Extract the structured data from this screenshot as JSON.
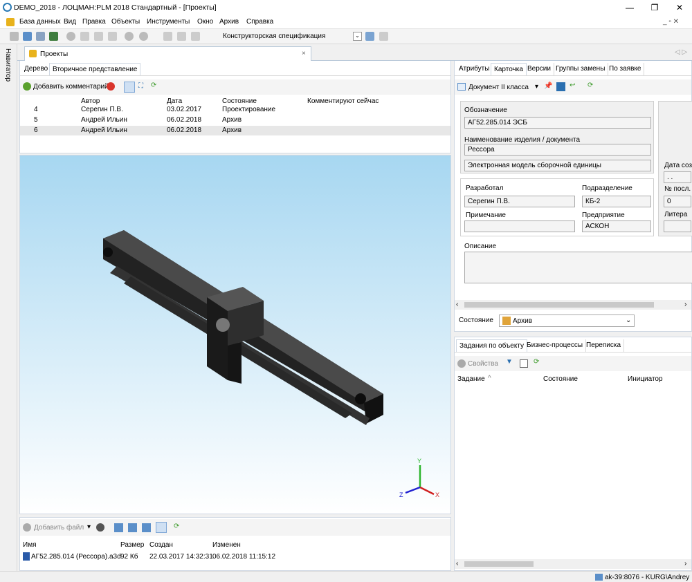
{
  "title": "DEMO_2018 - ЛОЦМАН:PLM 2018 Стандартный - [Проекты]",
  "menus": [
    "База данных",
    "Вид",
    "Правка",
    "Объекты",
    "Инструменты",
    "Окно",
    "Архив",
    "Справка"
  ],
  "toolbar_combo": "Конструкторская спецификация",
  "navigator_label": "Навигатор",
  "doc_tab": "Проекты",
  "left_tabs": [
    "Дерево",
    "Вторичное представление"
  ],
  "add_comment": "Добавить комментарий",
  "comment_table": {
    "headers": [
      "Автор",
      "Дата",
      "Состояние",
      "Комментируют сейчас"
    ],
    "rows": [
      [
        "4",
        "Серегин П.В.",
        "03.02.2017",
        "Проектирование"
      ],
      [
        "5",
        "Андрей Ильин",
        "06.02.2018",
        "Архив"
      ],
      [
        "6",
        "Андрей Ильин",
        "06.02.2018",
        "Архив"
      ]
    ]
  },
  "files": {
    "add": "Добавить файл",
    "headers": [
      "Имя",
      "Размер",
      "Создан",
      "Изменен"
    ],
    "row": [
      "АГ52.285.014 (Рессора).a3d",
      "92 Кб",
      "22.03.2017 14:32:31",
      "06.02.2018 11:15:12"
    ]
  },
  "right_tabs": [
    "Атрибуты",
    "Карточка",
    "Версии",
    "Группы замены",
    "По заявке"
  ],
  "doc_class": "Документ II класса",
  "card": {
    "designation_lbl": "Обозначение",
    "designation": "АГ52.285.014 ЭСБ",
    "name_lbl": "Наименование изделия / документа",
    "name": "Рессора",
    "name2": "Электронная модель сборочной единицы",
    "dev_lbl": "Разработал",
    "dev": "Серегин П.В.",
    "dept_lbl": "Подразделение",
    "dept": "КБ-2",
    "note_lbl": "Примечание",
    "ent_lbl": "Предприятие",
    "ent": "АСКОН",
    "date_lbl": "Дата созд",
    "date": ". .",
    "num_lbl": "№ посл.",
    "num": "0",
    "lit_lbl": "Литера",
    "desc_lbl": "Описание"
  },
  "state_lbl": "Состояние",
  "state": "Архив",
  "bottom_tabs": [
    "Задания по объекту",
    "Бизнес-процессы",
    "Переписка"
  ],
  "props": "Свойства",
  "task_headers": [
    "Задание",
    "Состояние",
    "Инициатор"
  ],
  "status": "ak-39:8076 - KURG\\Andrey",
  "axes": {
    "x": "X",
    "y": "Y",
    "z": "Z"
  }
}
